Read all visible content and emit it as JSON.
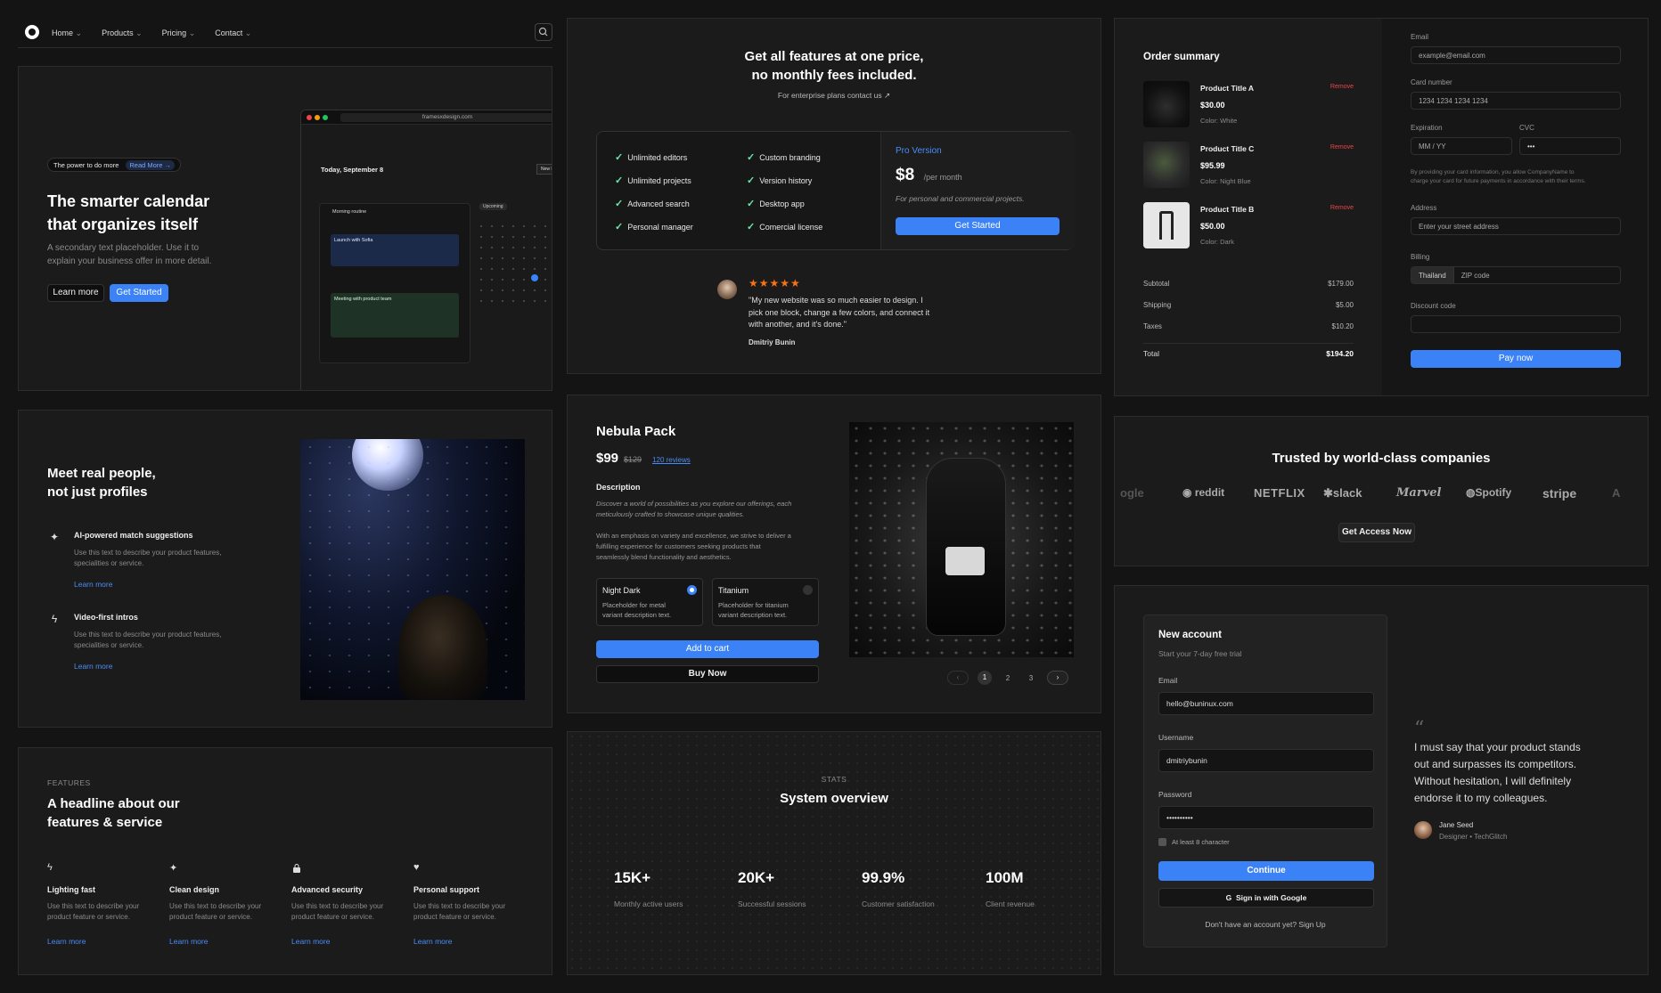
{
  "nav": {
    "items": [
      "Home",
      "Products",
      "Pricing",
      "Contact"
    ]
  },
  "hero": {
    "badge_text": "The power to do more",
    "badge_link": "Read More →",
    "title_line1": "The smarter calendar",
    "title_line2": "that organizes itself",
    "desc_line1": "A secondary text placeholder. Use it to",
    "desc_line2": "explain your business offer in more detail.",
    "learn_more": "Learn more",
    "get_started": "Get Started",
    "mock_url": "framesxdesign.com",
    "mock_date": "Today, September 8",
    "mock_event1": "Morning routine",
    "mock_event2": "Launch with Sofia",
    "mock_event3": "Meeting with product team",
    "mock_tab": "Upcoming",
    "mock_new": "New E"
  },
  "meet": {
    "title_line1": "Meet real people,",
    "title_line2": "not just profiles",
    "f1_title": "AI-powered match suggestions",
    "f1_desc1": "Use this text to describe your product features,",
    "f1_desc2": "specialities or service.",
    "f1_link": "Learn more",
    "f2_title": "Video-first intros",
    "f2_desc1": "Use this text to describe your product features,",
    "f2_desc2": "specialities or service.",
    "f2_link": "Learn more"
  },
  "features": {
    "eyebrow": "FEATURES",
    "title_line1": "A headline about our",
    "title_line2": "features & service",
    "items": [
      {
        "title": "Lighting fast",
        "d1": "Use this text to describe your",
        "d2": "product feature or service.",
        "link": "Learn more"
      },
      {
        "title": "Clean design",
        "d1": "Use this text to describe your",
        "d2": "product feature or service.",
        "link": "Learn more"
      },
      {
        "title": "Advanced security",
        "d1": "Use this text to describe your",
        "d2": "product feature or service.",
        "link": "Learn more"
      },
      {
        "title": "Personal support",
        "d1": "Use this text to describe your",
        "d2": "product feature or service.",
        "link": "Learn more"
      }
    ]
  },
  "pricing": {
    "title_line1": "Get all features at one price,",
    "title_line2": "no monthly fees included.",
    "enterprise": "For enterprise plans contact us ↗",
    "col1": [
      "Unlimited editors",
      "Unlimited projects",
      "Advanced search",
      "Personal manager"
    ],
    "col2": [
      "Custom branding",
      "Version history",
      "Desktop app",
      "Comercial license"
    ],
    "plan_name": "Pro Version",
    "price": "$8",
    "per": "/per month",
    "plan_desc": "For personal and commercial projects.",
    "cta": "Get Started",
    "stars": "★★★★★",
    "quote_line1": "\"My new website was so much easier to design. I",
    "quote_line2": "pick one block, change a few colors, and connect it",
    "quote_line3": "with another, and it's done.\"",
    "author": "Dmitriy Bunin"
  },
  "product": {
    "name": "Nebula Pack",
    "price": "$99",
    "old_price": "$129",
    "reviews": "120 reviews",
    "desc_heading": "Description",
    "italic1": "Discover a world of possibilities as you explore our offerings, each",
    "italic2": "meticulously crafted to showcase unique qualities.",
    "p1": "With an emphasis on variety and excellence, we strive to deliver a",
    "p2": "fulfilling experience for customers seeking products that",
    "p3": "seamlessly blend functionality and aesthetics.",
    "v1_title": "Night Dark",
    "v1_d1": "Placeholder for metal",
    "v1_d2": "variant description text.",
    "v2_title": "Titanium",
    "v2_d1": "Placeholder for titanium",
    "v2_d2": "variant description text.",
    "add_to_cart": "Add to cart",
    "buy_now": "Buy Now",
    "pages": [
      "1",
      "2",
      "3"
    ]
  },
  "stats": {
    "eyebrow": "STATS",
    "title": "System overview",
    "items": [
      {
        "value": "15K+",
        "label": "Monthly active users"
      },
      {
        "value": "20K+",
        "label": "Successful sessions"
      },
      {
        "value": "99.9%",
        "label": "Customer satisfaction"
      },
      {
        "value": "100M",
        "label": "Client revenue"
      }
    ]
  },
  "order": {
    "title": "Order summary",
    "items": [
      {
        "name": "Product Title A",
        "price": "$30.00",
        "color": "Color: White",
        "remove": "Remove"
      },
      {
        "name": "Product Title C",
        "price": "$95.99",
        "color": "Color: Night Blue",
        "remove": "Remove"
      },
      {
        "name": "Product Title B",
        "price": "$50.00",
        "color": "Color: Dark",
        "remove": "Remove"
      }
    ],
    "subtotal_label": "Subtotal",
    "subtotal": "$179.00",
    "shipping_label": "Shipping",
    "shipping": "$5.00",
    "taxes_label": "Taxes",
    "taxes": "$10.20",
    "total_label": "Total",
    "total": "$194.20"
  },
  "payment": {
    "email_label": "Email",
    "email_ph": "example@email.com",
    "card_label": "Card number",
    "card_ph": "1234 1234 1234 1234",
    "exp_label": "Expiration",
    "exp_ph": "MM / YY",
    "cvc_label": "CVC",
    "cvc_ph": "•••",
    "consent1": "By providing your card information, you allow CompanyName to",
    "consent2": "charge your card for future payments in accordance with their terms.",
    "address_label": "Address",
    "address_ph": "Enter your street address",
    "billing_label": "Billing",
    "country": "Thailand",
    "zip_ph": "ZIP code",
    "discount_label": "Discount code",
    "pay": "Pay now"
  },
  "trusted": {
    "title": "Trusted by world-class companies",
    "logos": [
      "ogle",
      "reddit",
      "NETFLIX",
      "slack",
      "Marvel",
      "Spotify",
      "stripe",
      "A"
    ],
    "cta": "Get Access Now"
  },
  "signup": {
    "title": "New account",
    "subtitle": "Start your 7-day free trial",
    "email_label": "Email",
    "email_val": "hello@buninux.com",
    "user_label": "Username",
    "user_val": "dmitriybunin",
    "pass_label": "Password",
    "pass_val": "••••••••••",
    "hint": "At least 8 character",
    "continue": "Continue",
    "google": "Sign in with Google",
    "footer": "Don't have an account yet? Sign Up",
    "quote_mark": "“",
    "quote1": "I must say that your product stands",
    "quote2": "out and surpasses its competitors.",
    "quote3": "Without hesitation, I will definitely",
    "quote4": "endorse it to my colleagues.",
    "author": "Jane Seed",
    "role": "Designer • TechGlitch"
  }
}
